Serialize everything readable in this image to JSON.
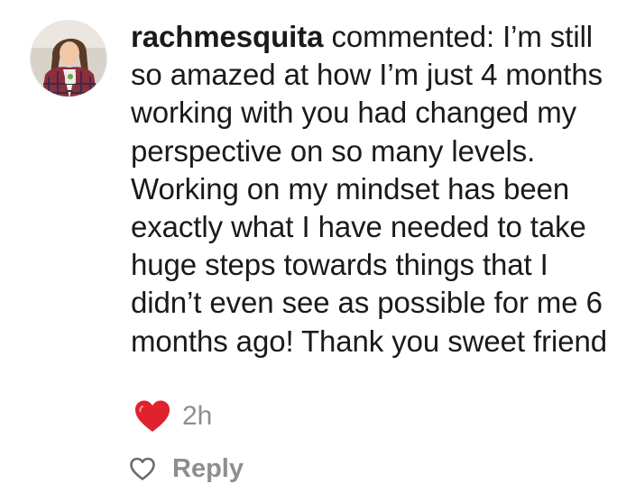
{
  "comment": {
    "username": "rachmesquita",
    "text": " commented: I’m still so amazed at how I’m just 4 months working with you had changed my perspective on so many levels.  Working on my mindset has been exactly what I have needed to take huge steps towards things that I didn’t even see as possible for me 6 months ago!  Thank you sweet friend"
  },
  "meta": {
    "reaction_icon": "red-heart-emoji",
    "timestamp": "2h"
  },
  "actions": {
    "like_icon": "heart-outline-icon",
    "reply_label": "Reply"
  },
  "colors": {
    "text": "#1a1a1a",
    "muted": "#8e8e8e",
    "heart": "#e0212e"
  }
}
